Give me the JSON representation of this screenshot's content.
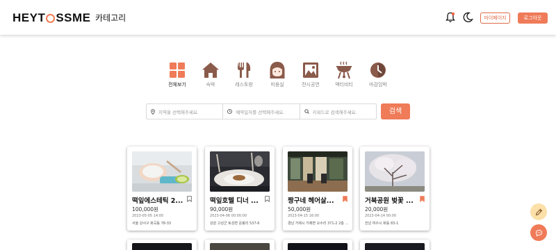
{
  "header": {
    "logo_left": "HEYT",
    "logo_right": "SSME",
    "logo_full": "HEYTOSSME",
    "category_menu": "카테고리",
    "mypage_button": "마이페이지",
    "logout_button": "로그아웃"
  },
  "categories": [
    {
      "label": "전체보기",
      "icon": "grid-icon",
      "active": true
    },
    {
      "label": "숙박",
      "icon": "house-icon",
      "active": false
    },
    {
      "label": "레스토랑",
      "icon": "fork-knife-icon",
      "active": false
    },
    {
      "label": "미용실",
      "icon": "hair-salon-icon",
      "active": false
    },
    {
      "label": "전시공연",
      "icon": "exhibition-icon",
      "active": false
    },
    {
      "label": "액티비티",
      "icon": "bbq-icon",
      "active": false
    },
    {
      "label": "마감임박",
      "icon": "deadline-clock-icon",
      "active": false
    }
  ],
  "search": {
    "region_placeholder": "지역을 선택해주세요.",
    "date_placeholder": "예약일자를 선택해주세요.",
    "keyword_placeholder": "키워드로 검색해주세요.",
    "search_button": "검색"
  },
  "cards": [
    {
      "title": "떡잎에스테틱 2...",
      "price": "100,000원",
      "date": "2023-05-05 14:00",
      "address": "서울 강서구 화곡동 78-33",
      "bookmarked": false
    },
    {
      "title": "떡잎호텔 디너 ...",
      "price": "90,000원",
      "date": "2023-04-06 00:00:00",
      "address": "강원 고성군 토성면 운봉리 537-6",
      "bookmarked": false
    },
    {
      "title": "짱구네 헤어살...",
      "price": "50,000원",
      "date": "2023-04-15 16:00",
      "address": "경남 거제시 거제면 오수리 371-2 2층 ...",
      "bookmarked": true
    },
    {
      "title": "거북공원 벚꽃 ...",
      "price": "20,000원",
      "date": "2023-04-14 00:00",
      "address": "전남 여수시 화동 83-1",
      "bookmarked": true
    }
  ],
  "colors": {
    "accent": "#ef7b58",
    "category_icon": "#8a5a4a",
    "bookmark_active": "#ef7b58"
  }
}
